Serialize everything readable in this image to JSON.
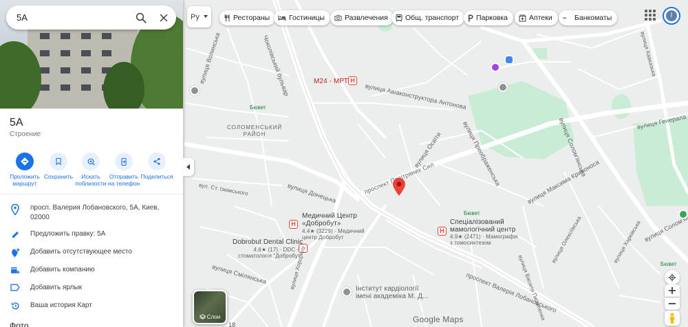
{
  "search": {
    "query": "5А"
  },
  "place": {
    "title": "5А",
    "type": "Строение"
  },
  "actions": [
    {
      "label": "Проложить\nмаршрут"
    },
    {
      "label": "Сохранить"
    },
    {
      "label": "Искать\nпоблизости"
    },
    {
      "label": "Отправить\nна телефон"
    },
    {
      "label": "Поделиться"
    }
  ],
  "info": {
    "address": "просп. Валерия Лобановского, 5А, Киев, 02000",
    "suggest_edit": "Предложить правку: 5А",
    "add_place": "Добавить отсутствующее место",
    "add_business": "Добавить компанию",
    "add_label": "Добавить ярлык",
    "history": "Ваша история Карт"
  },
  "photos_header": "Фото",
  "topbar": {
    "lang": "Ру",
    "chips": [
      "Рестораны",
      "Гостиницы",
      "Развлечения",
      "Общ. транспорт",
      "Парковка",
      "Аптеки",
      "Банкоматы"
    ],
    "avatar_letter": "I"
  },
  "map": {
    "labels": {
      "volynska": "вулиця Волинська",
      "chokolivskyi": "Чоколівський бульвар",
      "m24": "М24 - МРТ",
      "aviakonstruktora": "вулиця Авіаконструктора Антонова",
      "solomenskyi": "СОЛОМЕНСЬКИЙ\nРАЙОН",
      "biuvet1": "Бювет",
      "povitroflotskyi": "проспект Повітряних Сил",
      "osvity": "вулиця Освіти",
      "preobrazhenska": "вулиця Преображенська",
      "kryvonosa": "вулиця Максима Кривоноса",
      "donetska": "вулиця Донецька",
      "izhakevych": "вул. Ст. Ізюмського",
      "medcenter_name": "Медичний Центр\n«Добробут»",
      "medcenter_sub": "4.4★ (3229) · Медичний\nцентр Добробут",
      "dental_name": "Dobrobut Dental Clinic",
      "dental_sub": "4.8★ (17) · DDC —\nстоматологія \"Добробут\"",
      "mammology_name": "Спеціалізований\nмамологічний центр",
      "mammology_sub": "4.9★ (2471) · Мамографія\nз томосинтезом",
      "smilyanska": "вулиця Смілянська",
      "lobanovskoho": "проспект Валерія Лобановського",
      "kardiology": "Інститут кардіології\nімені академіка М. Д...",
      "kavkazka": "вулиця Кавказька",
      "henerala": "вулиця Генерала Ш",
      "solomyanska": "вулиця Солом'янська",
      "solomyanska2": "вулиця Солом'янська",
      "vasylia": "вулиця Василя Пилипенка",
      "oleksiivska": "вулиця Олексіївська",
      "kharkivska": "вулиця Харківська",
      "ploskoi": "вулиця Хоророго",
      "biuvet2": "Бювет",
      "biuvet3": "Бювет",
      "num18": "18"
    },
    "google_logo": "Google Maps"
  },
  "controls": {
    "layers_label": "Слои"
  },
  "colors": {
    "accent": "#1a73e8",
    "marker": "#ea4335",
    "park": "#c9ecd5",
    "road": "#ffffff",
    "map_bg": "#e9eaea"
  }
}
